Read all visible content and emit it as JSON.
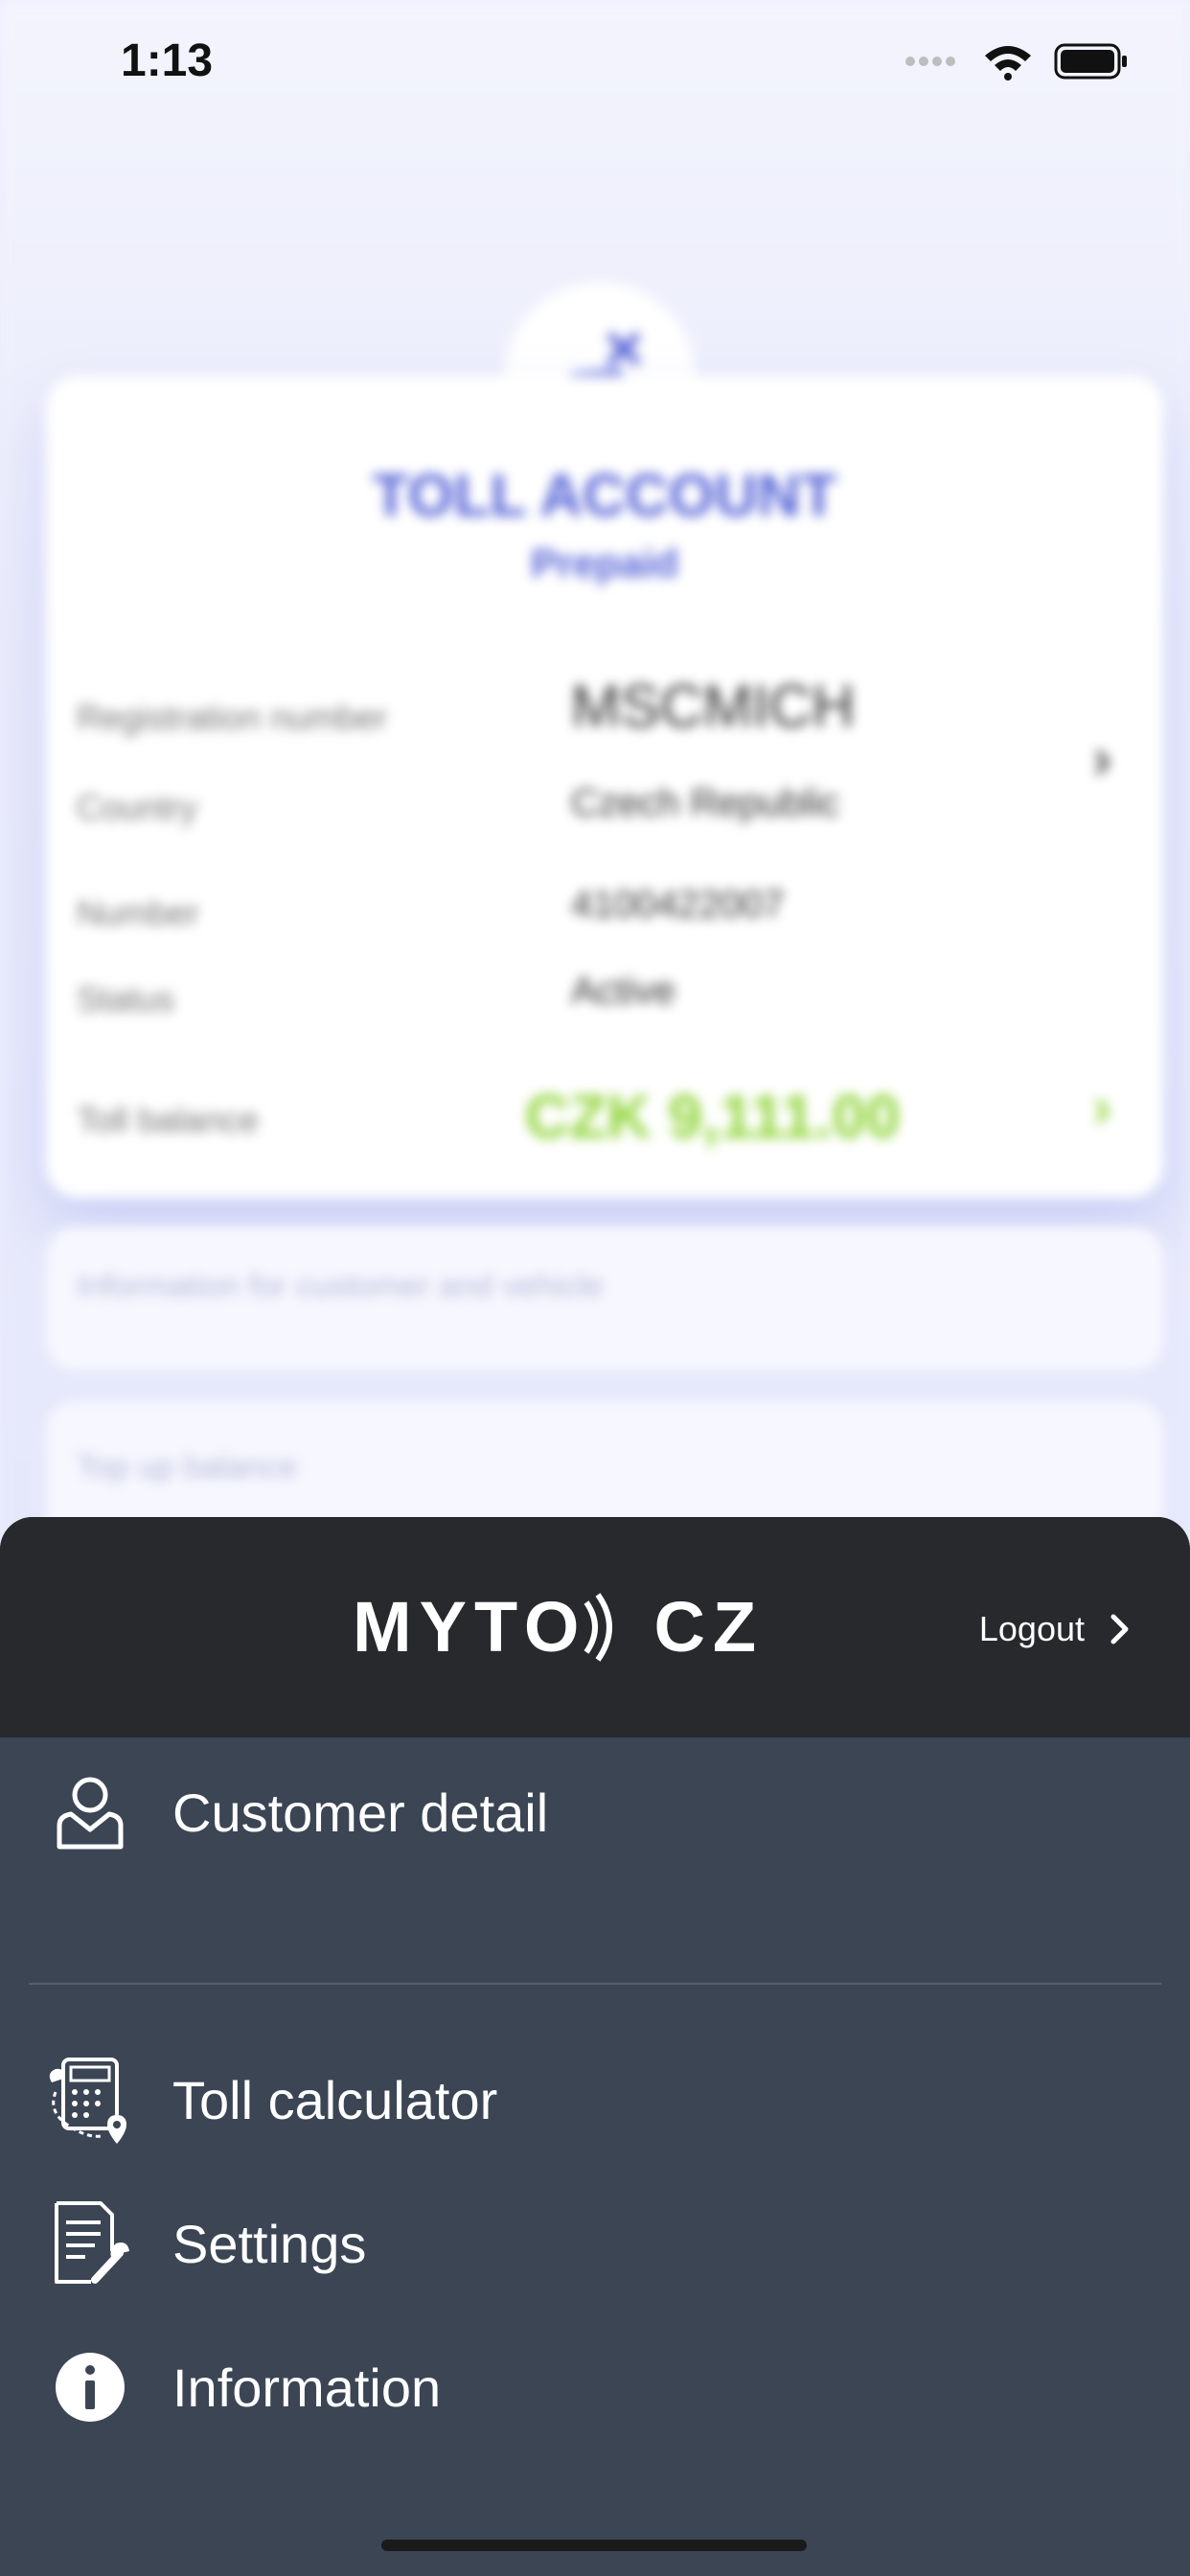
{
  "status": {
    "time": "1:13"
  },
  "account_card": {
    "title": "TOLL ACCOUNT",
    "subtitle": "Prepaid",
    "rows": [
      {
        "label": "Registration number",
        "value": "MSCMICH"
      },
      {
        "label": "Country",
        "value": "Czech Republic"
      },
      {
        "label": "Number",
        "value": "4100422007"
      },
      {
        "label": "Status",
        "value": "Active"
      }
    ],
    "balance_label": "Toll balance",
    "balance_value": "CZK 9,111.00"
  },
  "bg_boxes": [
    {
      "text": "Information for customer and vehicle"
    },
    {
      "text": "Top up balance"
    }
  ],
  "menu": {
    "logo_left": "MYTO",
    "logo_right": "CZ",
    "logout_label": "Logout",
    "items": [
      {
        "label": "Customer detail",
        "icon": "user-icon"
      },
      {
        "label": "Toll calculator",
        "icon": "calculator-icon"
      },
      {
        "label": "Settings",
        "icon": "settings-document-icon"
      },
      {
        "label": "Information",
        "icon": "info-icon"
      }
    ]
  },
  "colors": {
    "accent": "#5562d6",
    "balance": "#8fd438",
    "menu_bg": "#3b4554",
    "menu_header": "#27292c"
  }
}
